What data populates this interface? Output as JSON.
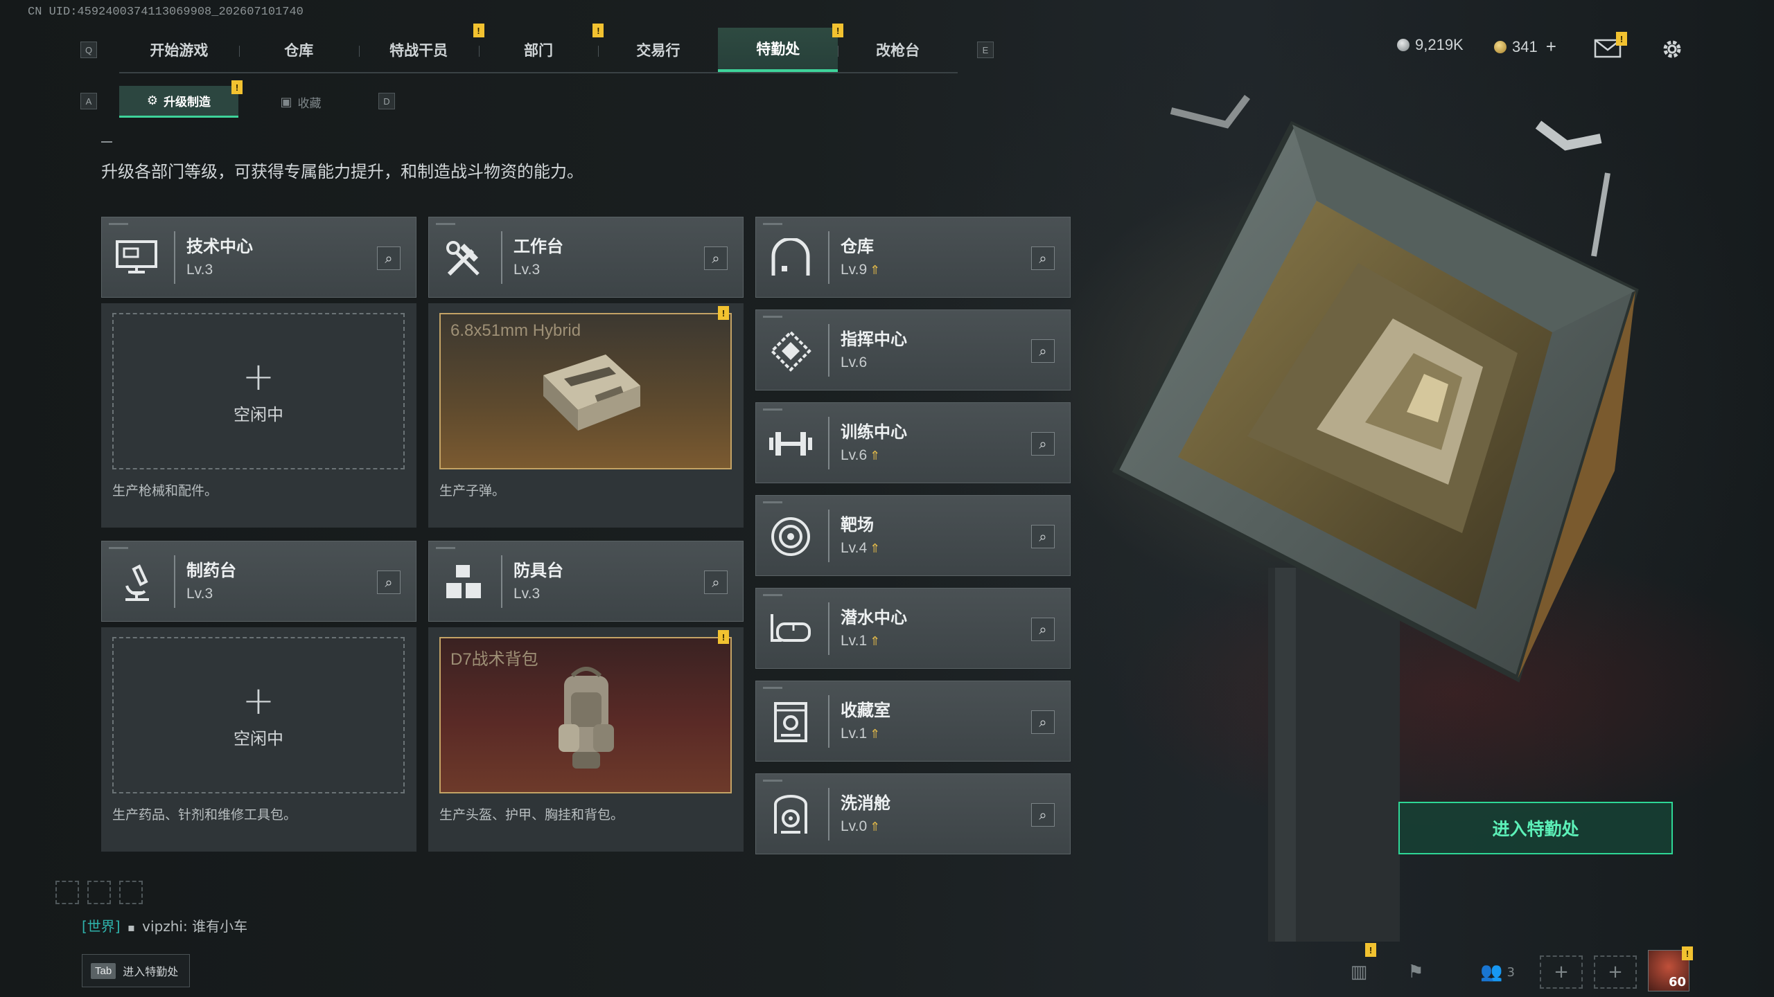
{
  "uid": "CN UID:4592400374113069908_202607101740",
  "nav": {
    "left_key": "Q",
    "right_key": "E",
    "tabs": [
      {
        "label": "开始游戏",
        "active": false,
        "alert": false
      },
      {
        "label": "仓库",
        "active": false,
        "alert": false
      },
      {
        "label": "特战干员",
        "active": false,
        "alert": true
      },
      {
        "label": "部门",
        "active": false,
        "alert": true
      },
      {
        "label": "交易行",
        "active": false,
        "alert": false
      },
      {
        "label": "特勤处",
        "active": true,
        "alert": true
      },
      {
        "label": "改枪台",
        "active": false,
        "alert": false
      }
    ]
  },
  "alert_mark": "!",
  "currency": {
    "silver": "9,219K",
    "gold": "341",
    "gold_add": "+"
  },
  "subnav": {
    "left_key": "A",
    "right_key": "D",
    "tabs": [
      {
        "label": "升级制造",
        "active": true
      },
      {
        "label": "收藏",
        "active": false
      }
    ]
  },
  "description": "升级各部门等级，可获得专属能力提升，和制造战斗物资的能力。",
  "workshops": [
    {
      "name": "技术中心",
      "level": "Lv.3",
      "icon": "computer-icon",
      "slot_state": "空闲中",
      "note": "生产枪械和配件。"
    },
    {
      "name": "工作台",
      "level": "Lv.3",
      "icon": "tools-icon",
      "crafting_item": "6.8x51mm Hybrid",
      "note": "生产子弹。"
    },
    {
      "name": "制药台",
      "level": "Lv.3",
      "icon": "microscope-icon",
      "slot_state": "空闲中",
      "note": "生产药品、针剂和维修工具包。"
    },
    {
      "name": "防具台",
      "level": "Lv.3",
      "icon": "cubes-icon",
      "crafting_item": "D7战术背包",
      "note": "生产头盔、护甲、胸挂和背包。"
    }
  ],
  "departments": [
    {
      "name": "仓库",
      "level": "Lv.9",
      "icon": "warehouse-icon",
      "upgrade": true
    },
    {
      "name": "指挥中心",
      "level": "Lv.6",
      "icon": "command-icon",
      "upgrade": false
    },
    {
      "name": "训练中心",
      "level": "Lv.6",
      "icon": "dumbbell-icon",
      "upgrade": true
    },
    {
      "name": "靶场",
      "level": "Lv.4",
      "icon": "target-icon",
      "upgrade": true
    },
    {
      "name": "潜水中心",
      "level": "Lv.1",
      "icon": "diving-mask-icon",
      "upgrade": true
    },
    {
      "name": "收藏室",
      "level": "Lv.1",
      "icon": "collection-icon",
      "upgrade": true
    },
    {
      "name": "洗消舱",
      "level": "Lv.0",
      "icon": "radiation-icon",
      "upgrade": true
    }
  ],
  "enter_button": "进入特勤处",
  "chat": {
    "channel": "[世界]",
    "user": "vipzhi",
    "message": "谁有小车"
  },
  "tab_hint": {
    "key": "Tab",
    "label": "进入特勤处"
  },
  "bottom_bar": {
    "squad_count": "3",
    "player_level": "60"
  },
  "colors": {
    "accent": "#3ed39a",
    "alert": "#f2c230",
    "upgrade": "#e0b84a",
    "craft_border": "#c4a365"
  }
}
